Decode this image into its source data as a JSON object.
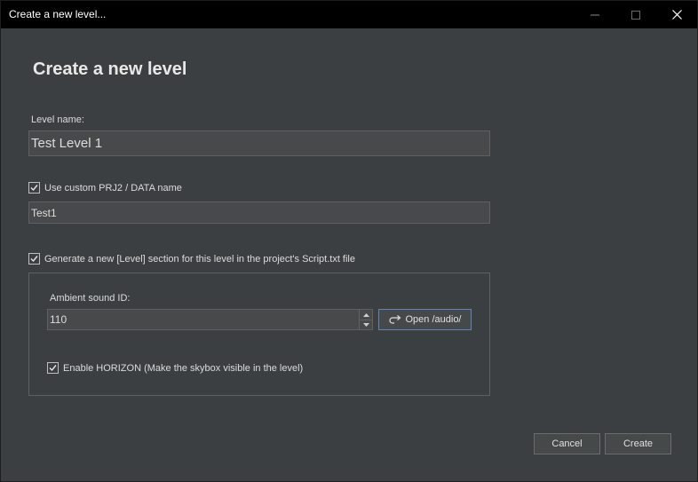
{
  "window": {
    "title": "Create a new level...",
    "controls": [
      "minimize-icon",
      "maximize-icon",
      "close-icon"
    ]
  },
  "heading": "Create a new level",
  "level_name": {
    "label": "Level name:",
    "value": "Test Level 1"
  },
  "custom_name": {
    "checkbox_label": "Use custom PRJ2 / DATA name",
    "checked": true,
    "value": "Test1"
  },
  "generate_section": {
    "checkbox_label": "Generate a new [Level] section for this level in the project's Script.txt file",
    "checked": true
  },
  "ambient_sound": {
    "label": "Ambient sound ID:",
    "value": "110",
    "open_button_label": "Open /audio/"
  },
  "horizon": {
    "checkbox_label": "Enable HORIZON (Make the skybox visible in the level)",
    "checked": true
  },
  "footer": {
    "cancel_label": "Cancel",
    "create_label": "Create"
  },
  "colors": {
    "background": "#3c3f41",
    "titlebar": "#000000",
    "input_bg": "#48494b",
    "accent_border": "#5b88b6"
  }
}
